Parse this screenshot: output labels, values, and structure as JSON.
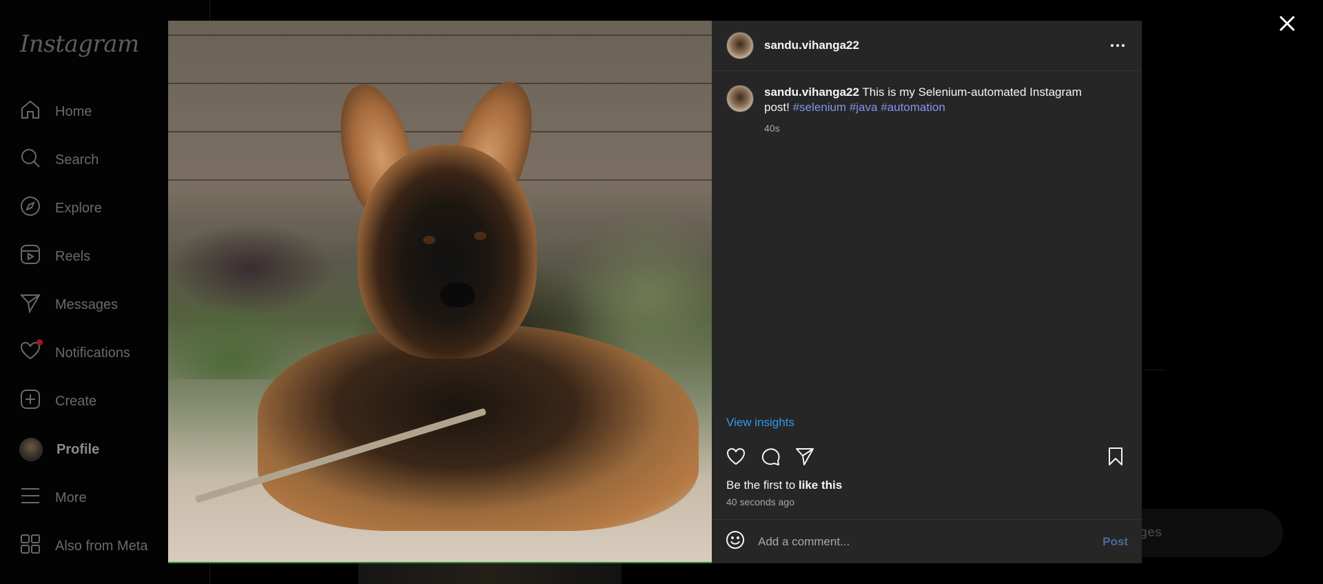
{
  "app": {
    "logo": "Instagram",
    "nav": [
      {
        "label": "Home",
        "icon": "home-icon"
      },
      {
        "label": "Search",
        "icon": "search-icon"
      },
      {
        "label": "Explore",
        "icon": "compass-icon"
      },
      {
        "label": "Reels",
        "icon": "reels-icon"
      },
      {
        "label": "Messages",
        "icon": "send-icon"
      },
      {
        "label": "Notifications",
        "icon": "heart-icon"
      },
      {
        "label": "Create",
        "icon": "plus-square-icon"
      },
      {
        "label": "Profile",
        "icon": "avatar"
      },
      {
        "label": "More",
        "icon": "menu-icon"
      },
      {
        "label": "Also from Meta",
        "icon": "grid-icon"
      }
    ],
    "background_messages_label": "ages"
  },
  "post": {
    "username": "sandu.vihanga22",
    "caption_text": "This is my Selenium-automated Instagram post!",
    "hashtags": [
      "#selenium",
      "#java",
      "#automation"
    ],
    "caption_age": "40s",
    "view_insights": "View insights",
    "likes_prefix": "Be the first to",
    "likes_link": "like this",
    "posted_ago": "40 seconds ago",
    "comment_placeholder": "Add a comment...",
    "post_button": "Post"
  },
  "colors": {
    "hashtag": "#8096e8",
    "insights_link": "#2c9af3",
    "notification_dot": "#a3162a"
  }
}
